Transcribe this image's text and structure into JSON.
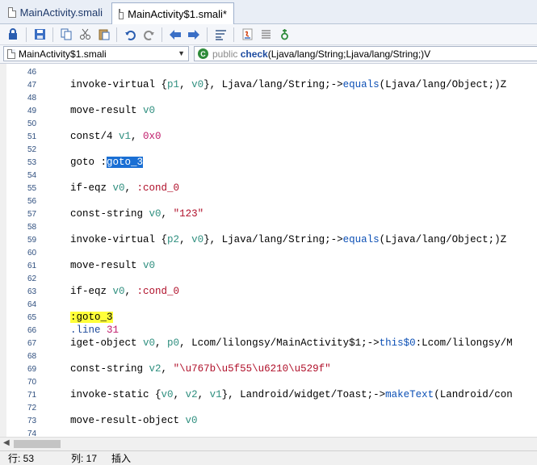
{
  "tabs": [
    {
      "label": "MainActivity.smali",
      "active": false
    },
    {
      "label": "MainActivity$1.smali*",
      "active": true
    }
  ],
  "toolbar": {
    "icons": [
      "lock-icon",
      "save-icon",
      "copy-icon",
      "cut-icon",
      "paste-icon",
      "undo-icon",
      "redo-icon",
      "back-icon",
      "forward-icon",
      "wrap-icon",
      "java-icon",
      "list-icon",
      "build-icon"
    ]
  },
  "nav": {
    "file_combo": "MainActivity$1.smali",
    "method_modifier": "public",
    "method_name": "check",
    "method_signature": "(Ljava/lang/String;Ljava/lang/String;)V"
  },
  "code_lines": [
    {
      "n": "46",
      "parts": []
    },
    {
      "n": "47",
      "parts": [
        [
          "op",
          "invoke-virtual "
        ],
        [
          "op",
          "{"
        ],
        [
          "reg",
          "p1"
        ],
        [
          "op",
          ", "
        ],
        [
          "reg",
          "v0"
        ],
        [
          "op",
          "}, Ljava/lang/String;->"
        ],
        [
          "meth",
          "equals"
        ],
        [
          "op",
          "(Ljava/lang/Object;)Z"
        ]
      ]
    },
    {
      "n": "48",
      "parts": []
    },
    {
      "n": "49",
      "parts": [
        [
          "op",
          "move-result "
        ],
        [
          "reg",
          "v0"
        ]
      ]
    },
    {
      "n": "50",
      "parts": []
    },
    {
      "n": "51",
      "parts": [
        [
          "op",
          "const/4 "
        ],
        [
          "reg",
          "v1"
        ],
        [
          "op",
          ", "
        ],
        [
          "num",
          "0x0"
        ]
      ]
    },
    {
      "n": "52",
      "parts": []
    },
    {
      "n": "53",
      "parts": [
        [
          "op",
          "goto "
        ],
        [
          "op",
          ":"
        ],
        [
          "sel",
          "goto_3"
        ]
      ]
    },
    {
      "n": "54",
      "parts": []
    },
    {
      "n": "55",
      "parts": [
        [
          "op",
          "if-eqz "
        ],
        [
          "reg",
          "v0"
        ],
        [
          "op",
          ", "
        ],
        [
          "lbl",
          ":cond_0"
        ]
      ]
    },
    {
      "n": "56",
      "parts": []
    },
    {
      "n": "57",
      "parts": [
        [
          "op",
          "const-string "
        ],
        [
          "reg",
          "v0"
        ],
        [
          "op",
          ", "
        ],
        [
          "str",
          "\"123\""
        ]
      ]
    },
    {
      "n": "58",
      "parts": []
    },
    {
      "n": "59",
      "parts": [
        [
          "op",
          "invoke-virtual "
        ],
        [
          "op",
          "{"
        ],
        [
          "reg",
          "p2"
        ],
        [
          "op",
          ", "
        ],
        [
          "reg",
          "v0"
        ],
        [
          "op",
          "}, Ljava/lang/String;->"
        ],
        [
          "meth",
          "equals"
        ],
        [
          "op",
          "(Ljava/lang/Object;)Z"
        ]
      ]
    },
    {
      "n": "60",
      "parts": []
    },
    {
      "n": "61",
      "parts": [
        [
          "op",
          "move-result "
        ],
        [
          "reg",
          "v0"
        ]
      ]
    },
    {
      "n": "62",
      "parts": []
    },
    {
      "n": "63",
      "parts": [
        [
          "op",
          "if-eqz "
        ],
        [
          "reg",
          "v0"
        ],
        [
          "op",
          ", "
        ],
        [
          "lbl",
          ":cond_0"
        ]
      ]
    },
    {
      "n": "64",
      "parts": []
    },
    {
      "n": "65",
      "parts": [
        [
          "hl",
          ":goto_3"
        ]
      ]
    },
    {
      "n": "66",
      "parts": [
        [
          "dirv",
          ".line "
        ],
        [
          "num",
          "31"
        ]
      ]
    },
    {
      "n": "67",
      "parts": [
        [
          "op",
          "iget-object "
        ],
        [
          "reg",
          "v0"
        ],
        [
          "op",
          ", "
        ],
        [
          "reg",
          "p0"
        ],
        [
          "op",
          ", Lcom/lilongsy/MainActivity$1;->"
        ],
        [
          "meth",
          "this$0"
        ],
        [
          "op",
          ":Lcom/lilongsy/M"
        ]
      ]
    },
    {
      "n": "68",
      "parts": []
    },
    {
      "n": "69",
      "parts": [
        [
          "op",
          "const-string "
        ],
        [
          "reg",
          "v2"
        ],
        [
          "op",
          ", "
        ],
        [
          "str",
          "\"\\u767b\\u5f55\\u6210\\u529f\""
        ]
      ]
    },
    {
      "n": "70",
      "parts": []
    },
    {
      "n": "71",
      "parts": [
        [
          "op",
          "invoke-static "
        ],
        [
          "op",
          "{"
        ],
        [
          "reg",
          "v0"
        ],
        [
          "op",
          ", "
        ],
        [
          "reg",
          "v2"
        ],
        [
          "op",
          ", "
        ],
        [
          "reg",
          "v1"
        ],
        [
          "op",
          "}, Landroid/widget/Toast;->"
        ],
        [
          "meth",
          "makeText"
        ],
        [
          "op",
          "(Landroid/con"
        ]
      ]
    },
    {
      "n": "72",
      "parts": []
    },
    {
      "n": "73",
      "parts": [
        [
          "op",
          "move-result-object "
        ],
        [
          "reg",
          "v0"
        ]
      ]
    },
    {
      "n": "74",
      "parts": []
    }
  ],
  "status": {
    "row": "行: 53",
    "col": "列: 17",
    "mode": "插入"
  }
}
